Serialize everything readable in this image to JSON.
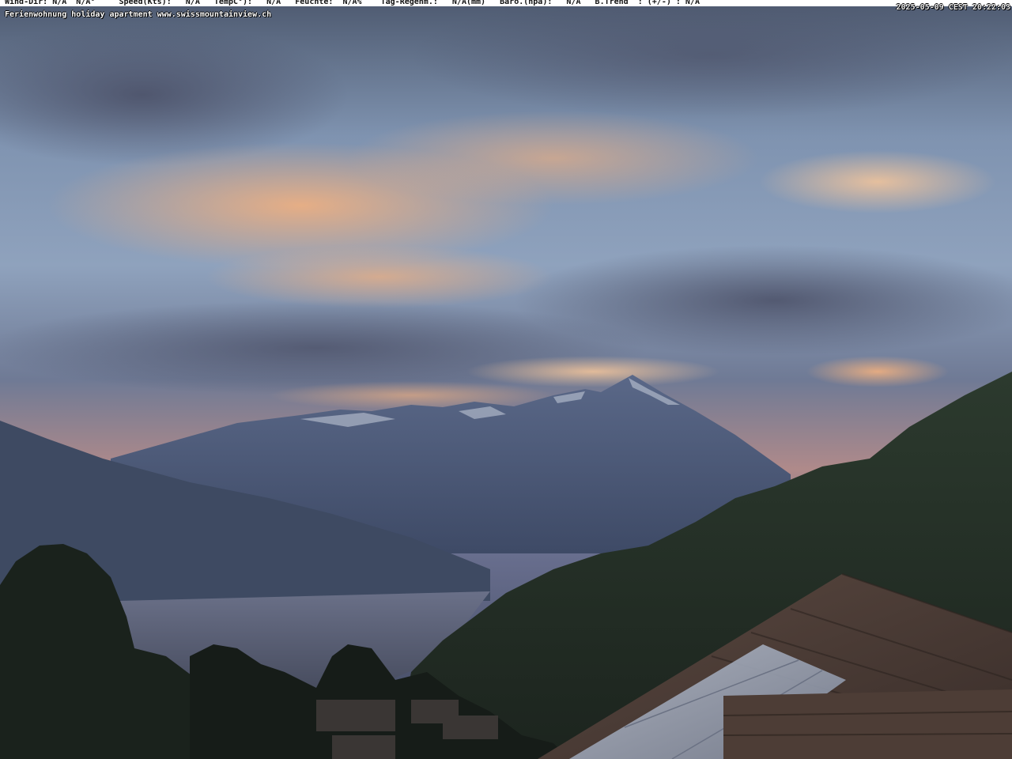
{
  "overlay": {
    "line1": "Wind-Dir: N/A  N/A°     Speed(Kts):   N/A   TempC°):   N/A   Feuchte:  N/A%    Tag-Regenm.:   N/A(mm)   Baro.(hpa):   N/A   B.Trend  : (+/-) : N/A",
    "timestamp": "2025-05-09 CEST 20:22:03",
    "line2": "Ferienwohnung holiday apartment www.swissmountainview.ch"
  },
  "colors": {
    "sky_top": "#5f6e86",
    "sky_mid": "#8fa3bf",
    "cloud_glow": "#e8a27a",
    "mountain_far": "#4a5a78",
    "lake": "#5a6078",
    "forest": "#1f2a22",
    "roof": "#4a3a34",
    "solar_panel": "#9aa4b4"
  }
}
